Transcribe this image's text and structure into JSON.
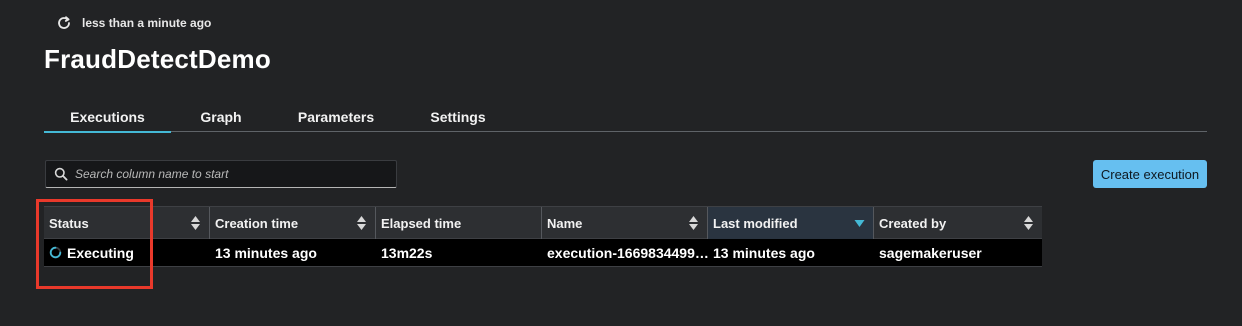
{
  "header": {
    "refresh_icon": "refresh-icon",
    "refresh_text": "less than a minute ago",
    "title": "FraudDetectDemo"
  },
  "tabs": [
    {
      "label": "Executions",
      "active": true
    },
    {
      "label": "Graph",
      "active": false
    },
    {
      "label": "Parameters",
      "active": false
    },
    {
      "label": "Settings",
      "active": false
    }
  ],
  "search": {
    "icon": "search-icon",
    "placeholder": "Search column name to start",
    "value": ""
  },
  "create_button": {
    "label": "Create execution"
  },
  "table": {
    "columns": [
      {
        "label": "Status",
        "sort": "none"
      },
      {
        "label": "Creation time",
        "sort": "none"
      },
      {
        "label": "Elapsed time",
        "sort": "none"
      },
      {
        "label": "Name",
        "sort": "none"
      },
      {
        "label": "Last modified",
        "sort": "descending"
      },
      {
        "label": "Created by",
        "sort": "none"
      }
    ],
    "rows": [
      {
        "status": "Executing",
        "status_icon": "spinner-icon",
        "creation_time": "13 minutes ago",
        "elapsed_time": "13m22s",
        "name": "execution-1669834499…",
        "last_modified": "13 minutes ago",
        "created_by": "sagemakeruser"
      }
    ]
  },
  "colors": {
    "background": "#222325",
    "accent_tab": "#44b9d6",
    "primary_button": "#66bff0",
    "highlight": "#e9392b"
  }
}
